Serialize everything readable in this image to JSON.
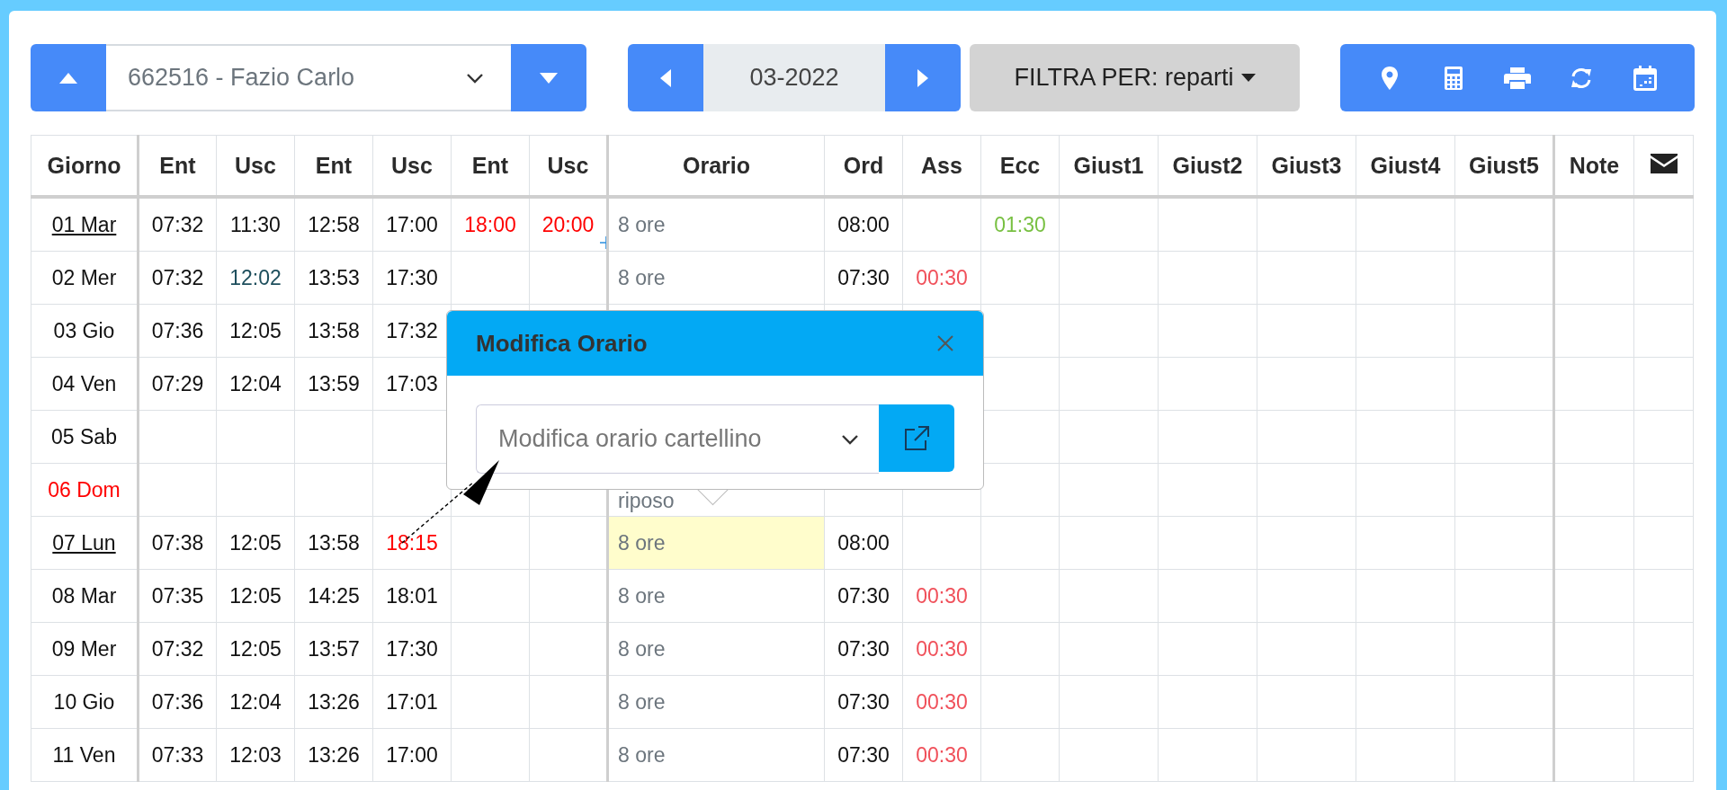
{
  "toolbar": {
    "employee_select": {
      "value": "662516 - Fazio Carlo"
    },
    "period": "03-2022",
    "filter_button": "FILTRA PER: reparti"
  },
  "table": {
    "columns": [
      "Giorno",
      "Ent",
      "Usc",
      "Ent",
      "Usc",
      "Ent",
      "Usc",
      "Orario",
      "Ord",
      "Ass",
      "Ecc",
      "Giust1",
      "Giust2",
      "Giust3",
      "Giust4",
      "Giust5",
      "Note"
    ],
    "rows": [
      {
        "day": "01 Mar",
        "linked": true,
        "holiday": false,
        "punches": {
          "ent1": "07:32",
          "usc1": "11:30",
          "ent2": "12:58",
          "usc2": "17:00",
          "ent3": {
            "text": "18:00",
            "color": "#ff0000"
          },
          "usc3": {
            "text": "20:00",
            "color": "#ff0000"
          }
        },
        "orario": "8 ore",
        "ord": "08:00",
        "ecc": "01:30"
      },
      {
        "day": "02 Mer",
        "linked": false,
        "holiday": false,
        "punches": {
          "ent1": "07:32",
          "usc1": {
            "text": "12:02",
            "color": "#1d4e5c"
          },
          "ent2": "13:53",
          "usc2": "17:30"
        },
        "orario": "8 ore",
        "ord": "07:30",
        "ass": "00:30"
      },
      {
        "day": "03 Gio",
        "linked": false,
        "holiday": false,
        "punches": {
          "ent1": "07:36",
          "usc1": "12:05",
          "ent2": "13:58",
          "usc2": "17:32"
        }
      },
      {
        "day": "04 Ven",
        "linked": false,
        "holiday": false,
        "punches": {
          "ent1": "07:29",
          "usc1": "12:04",
          "ent2": "13:59",
          "usc2": "17:03"
        }
      },
      {
        "day": "05 Sab",
        "linked": false,
        "holiday": false
      },
      {
        "day": "06 Dom",
        "linked": false,
        "holiday": true,
        "orario": "riposo"
      },
      {
        "day": "07 Lun",
        "linked": true,
        "holiday": false,
        "punches": {
          "ent1": "07:38",
          "usc1": "12:05",
          "ent2": "13:58",
          "usc2": {
            "text": "18:15",
            "color": "#ff0000"
          }
        },
        "orario": "8 ore",
        "orario_selected": true,
        "ord": "08:00"
      },
      {
        "day": "08 Mar",
        "linked": false,
        "holiday": false,
        "punches": {
          "ent1": "07:35",
          "usc1": "12:05",
          "ent2": "14:25",
          "usc2": "18:01"
        },
        "orario": "8 ore",
        "ord": "07:30",
        "ass": "00:30"
      },
      {
        "day": "09 Mer",
        "linked": false,
        "holiday": false,
        "punches": {
          "ent1": "07:32",
          "usc1": "12:05",
          "ent2": "13:57",
          "usc2": "17:30"
        },
        "orario": "8 ore",
        "ord": "07:30",
        "ass": "00:30"
      },
      {
        "day": "10 Gio",
        "linked": false,
        "holiday": false,
        "punches": {
          "ent1": "07:36",
          "usc1": "12:04",
          "ent2": "13:26",
          "usc2": "17:01"
        },
        "orario": "8 ore",
        "ord": "07:30",
        "ass": "00:30"
      },
      {
        "day": "11 Ven",
        "linked": false,
        "holiday": false,
        "punches": {
          "ent1": "07:33",
          "usc1": "12:03",
          "ent2": "13:26",
          "usc2": "17:00"
        },
        "orario": "8 ore",
        "ord": "07:30",
        "ass": "00:30"
      }
    ]
  },
  "popover": {
    "title": "Modifica Orario",
    "select": {
      "placeholder": "Modifica orario cartellino"
    }
  }
}
